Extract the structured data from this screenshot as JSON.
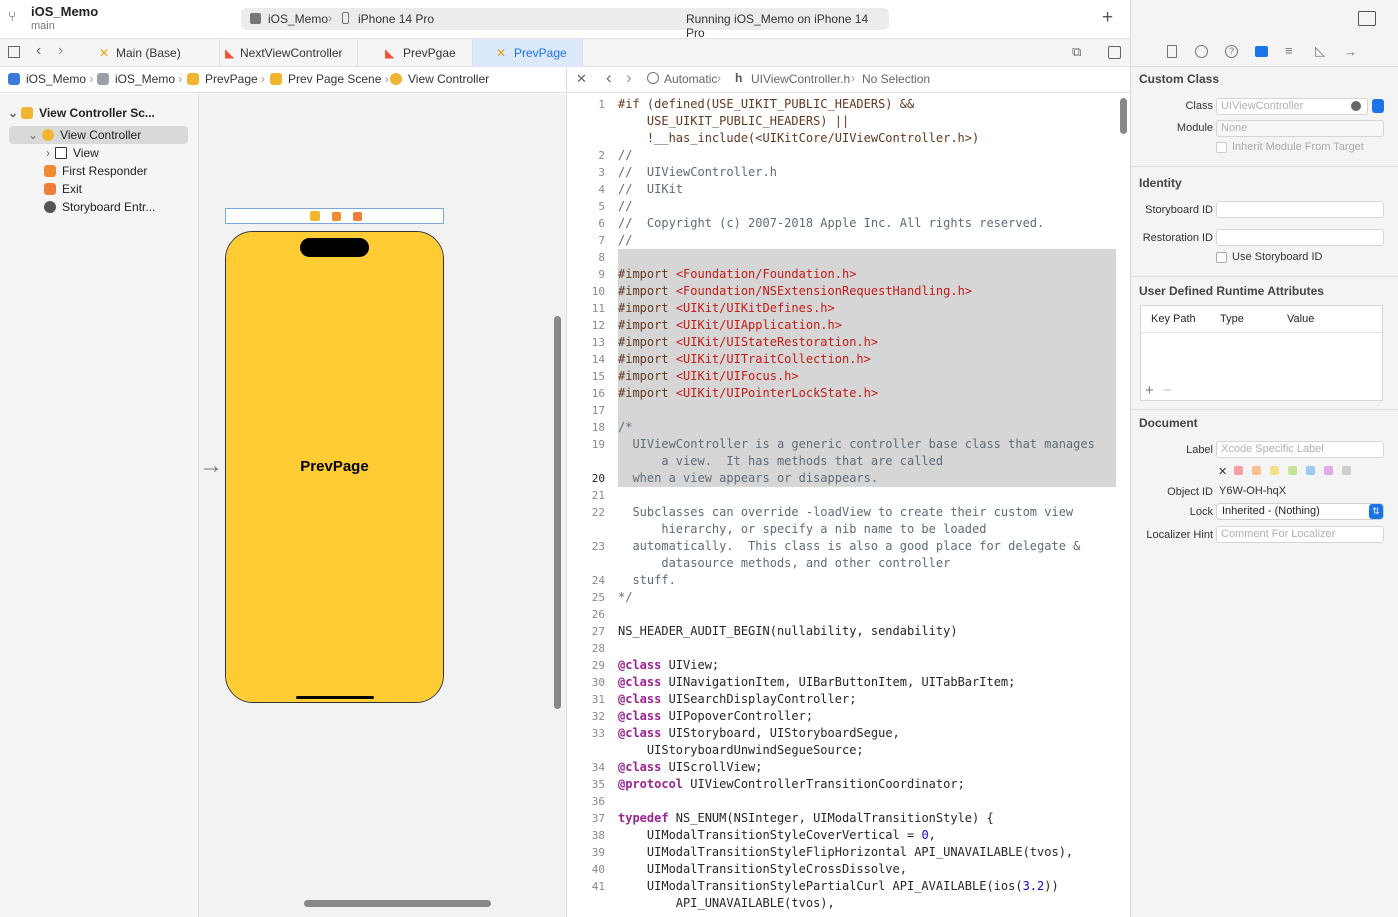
{
  "toolbar": {
    "project_name": "iOS_Memo",
    "branch": "main",
    "scheme": "iOS_Memo",
    "device": "iPhone 14 Pro",
    "status": "Running iOS_Memo on iPhone 14 Pro",
    "add_label": "+"
  },
  "tabs": [
    {
      "label": "Main (Base)"
    },
    {
      "label": "NextViewController"
    },
    {
      "label": "PrevPgae"
    },
    {
      "label": "PrevPage"
    }
  ],
  "breadcrumb_left": [
    "iOS_Memo",
    "iOS_Memo",
    "PrevPage",
    "Prev Page Scene",
    "View Controller"
  ],
  "breadcrumb_right": {
    "mode": "Automatic",
    "file": "UIViewController.h",
    "selection": "No Selection"
  },
  "outline": {
    "scene": "View Controller Sc...",
    "items": [
      {
        "label": "View Controller"
      },
      {
        "label": "View"
      },
      {
        "label": "First Responder"
      },
      {
        "label": "Exit"
      },
      {
        "label": "Storyboard Entr..."
      }
    ]
  },
  "canvas": {
    "screen_title": "PrevPage",
    "screen_color": "#ffcc33"
  },
  "code": {
    "lines": [
      {
        "n": "1",
        "html": "#if (defined(USE_UIKIT_PUBLIC_HEADERS) &&"
      },
      {
        "n": "",
        "html": "    USE_UIKIT_PUBLIC_HEADERS) ||"
      },
      {
        "n": "",
        "html": "    !__has_include(<UIKitCore/UIViewController.h>)"
      },
      {
        "n": "2",
        "html": "//"
      },
      {
        "n": "3",
        "html": "//  UIViewController.h"
      },
      {
        "n": "4",
        "html": "//  UIKit"
      },
      {
        "n": "5",
        "html": "//"
      },
      {
        "n": "6",
        "html": "//  Copyright (c) 2007-2018 Apple Inc. All rights reserved."
      },
      {
        "n": "7",
        "html": "//"
      },
      {
        "n": "8",
        "html": ""
      },
      {
        "n": "9",
        "html": "#import <Foundation/Foundation.h>"
      },
      {
        "n": "10",
        "html": "#import <Foundation/NSExtensionRequestHandling.h>"
      },
      {
        "n": "11",
        "html": "#import <UIKit/UIKitDefines.h>"
      },
      {
        "n": "12",
        "html": "#import <UIKit/UIApplication.h>"
      },
      {
        "n": "13",
        "html": "#import <UIKit/UIStateRestoration.h>"
      },
      {
        "n": "14",
        "html": "#import <UIKit/UITraitCollection.h>"
      },
      {
        "n": "15",
        "html": "#import <UIKit/UIFocus.h>"
      },
      {
        "n": "16",
        "html": "#import <UIKit/UIPointerLockState.h>"
      },
      {
        "n": "17",
        "html": ""
      },
      {
        "n": "18",
        "html": "/*"
      },
      {
        "n": "19",
        "html": "  UIViewController is a generic controller base class that manages"
      },
      {
        "n": "",
        "html": "      a view.  It has methods that are called"
      },
      {
        "n": "20",
        "html": "  when a view appears or disappears."
      },
      {
        "n": "21",
        "html": ""
      },
      {
        "n": "22",
        "html": "  Subclasses can override -loadView to create their custom view"
      },
      {
        "n": "",
        "html": "      hierarchy, or specify a nib name to be loaded"
      },
      {
        "n": "23",
        "html": "  automatically.  This class is also a good place for delegate &"
      },
      {
        "n": "",
        "html": "      datasource methods, and other controller"
      },
      {
        "n": "24",
        "html": "  stuff."
      },
      {
        "n": "25",
        "html": "*/"
      },
      {
        "n": "26",
        "html": ""
      },
      {
        "n": "27",
        "html": "NS_HEADER_AUDIT_BEGIN(nullability, sendability)"
      },
      {
        "n": "28",
        "html": ""
      },
      {
        "n": "29",
        "html": "@class UIView;"
      },
      {
        "n": "30",
        "html": "@class UINavigationItem, UIBarButtonItem, UITabBarItem;"
      },
      {
        "n": "31",
        "html": "@class UISearchDisplayController;"
      },
      {
        "n": "32",
        "html": "@class UIPopoverController;"
      },
      {
        "n": "33",
        "html": "@class UIStoryboard, UIStoryboardSegue,"
      },
      {
        "n": "",
        "html": "    UIStoryboardUnwindSegueSource;"
      },
      {
        "n": "34",
        "html": "@class UIScrollView;"
      },
      {
        "n": "35",
        "html": "@protocol UIViewControllerTransitionCoordinator;"
      },
      {
        "n": "36",
        "html": ""
      },
      {
        "n": "37",
        "html": "typedef NS_ENUM(NSInteger, UIModalTransitionStyle) {"
      },
      {
        "n": "38",
        "html": "    UIModalTransitionStyleCoverVertical = 0,"
      },
      {
        "n": "39",
        "html": "    UIModalTransitionStyleFlipHorizontal API_UNAVAILABLE(tvos),"
      },
      {
        "n": "40",
        "html": "    UIModalTransitionStyleCrossDissolve,"
      },
      {
        "n": "41",
        "html": "    UIModalTransitionStylePartialCurl API_AVAILABLE(ios(3.2))"
      },
      {
        "n": "",
        "html": "        API_UNAVAILABLE(tvos),"
      }
    ]
  },
  "inspector": {
    "custom_class": {
      "title": "Custom Class",
      "class_label": "Class",
      "class_placeholder": "UIViewController",
      "module_label": "Module",
      "module_value": "None",
      "inherit_label": "Inherit Module From Target"
    },
    "identity": {
      "title": "Identity",
      "storyboard_id_label": "Storyboard ID",
      "restoration_id_label": "Restoration ID",
      "use_storyboard_id_label": "Use Storyboard ID"
    },
    "runtime_attrs": {
      "title": "User Defined Runtime Attributes",
      "columns": [
        "Key Path",
        "Type",
        "Value"
      ]
    },
    "document": {
      "title": "Document",
      "label_label": "Label",
      "label_placeholder": "Xcode Specific Label",
      "swatch_colors": [
        "#f7a0a0",
        "#f8c08a",
        "#f5e08a",
        "#c7e59a",
        "#9ec9f5",
        "#e1a9ea",
        "#cfcfcf"
      ],
      "object_id_label": "Object ID",
      "object_id_value": "Y6W-OH-hqX",
      "lock_label": "Lock",
      "lock_value": "Inherited - (Nothing)",
      "localizer_label": "Localizer Hint",
      "localizer_placeholder": "Comment For Localizer"
    }
  }
}
